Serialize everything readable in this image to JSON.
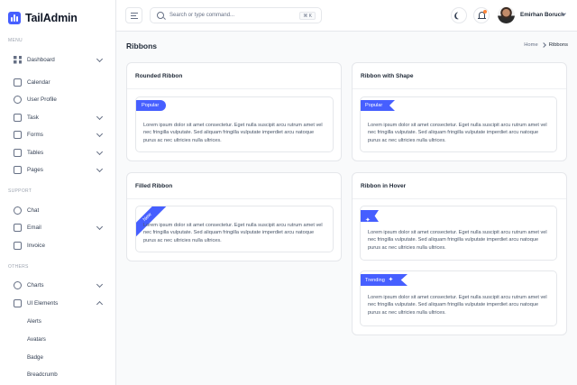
{
  "app": {
    "name": "TailAdmin"
  },
  "sidebar": {
    "sections": {
      "menu": "MENU",
      "support": "SUPPORT",
      "others": "OTHERS"
    },
    "menu_items": [
      {
        "label": "Dashboard",
        "icon": "grid-icon"
      },
      {
        "label": "Calendar",
        "icon": "calendar-icon"
      },
      {
        "label": "User Profile",
        "icon": "user-icon"
      },
      {
        "label": "Task",
        "icon": "task-icon"
      },
      {
        "label": "Forms",
        "icon": "forms-icon"
      },
      {
        "label": "Tables",
        "icon": "tables-icon"
      },
      {
        "label": "Pages",
        "icon": "pages-icon"
      }
    ],
    "support_items": [
      {
        "label": "Chat",
        "icon": "chat-icon"
      },
      {
        "label": "Email",
        "icon": "email-icon"
      },
      {
        "label": "Invoice",
        "icon": "invoice-icon"
      }
    ],
    "others_items": [
      {
        "label": "Charts",
        "icon": "pie-chart-icon"
      },
      {
        "label": "UI Elements",
        "icon": "box-icon"
      }
    ],
    "ui_elements_sub": [
      "Alerts",
      "Avatars",
      "Badge",
      "Breadcrumb"
    ]
  },
  "header": {
    "search_placeholder": "Search or type command...",
    "search_shortcut": "⌘ K",
    "user_name": "Emirhan Boruch"
  },
  "page": {
    "title": "Ribbons",
    "breadcrumb": {
      "home": "Home",
      "current": "Ribbons"
    }
  },
  "cards": {
    "rounded": {
      "title": "Rounded Ribbon",
      "ribbon": "Popular"
    },
    "shape": {
      "title": "Ribbon with Shape",
      "ribbon": "Popular"
    },
    "filled": {
      "title": "Filled Ribbon",
      "ribbon": "New"
    },
    "hover": {
      "title": "Ribbon in Hover",
      "ribbon_trending": "Trending"
    }
  },
  "lorem": "Lorem ipsum dolor sit amet consectetur. Eget nulla suscipit arcu rutrum amet vel nec fringilla vulputate. Sed aliquam fringilla vulputate imperdiet arcu natoque purus ac nec ultricies nulla ultrices.",
  "colors": {
    "accent": "#465fff",
    "notification": "#fd853a",
    "border": "#e5e7eb"
  }
}
